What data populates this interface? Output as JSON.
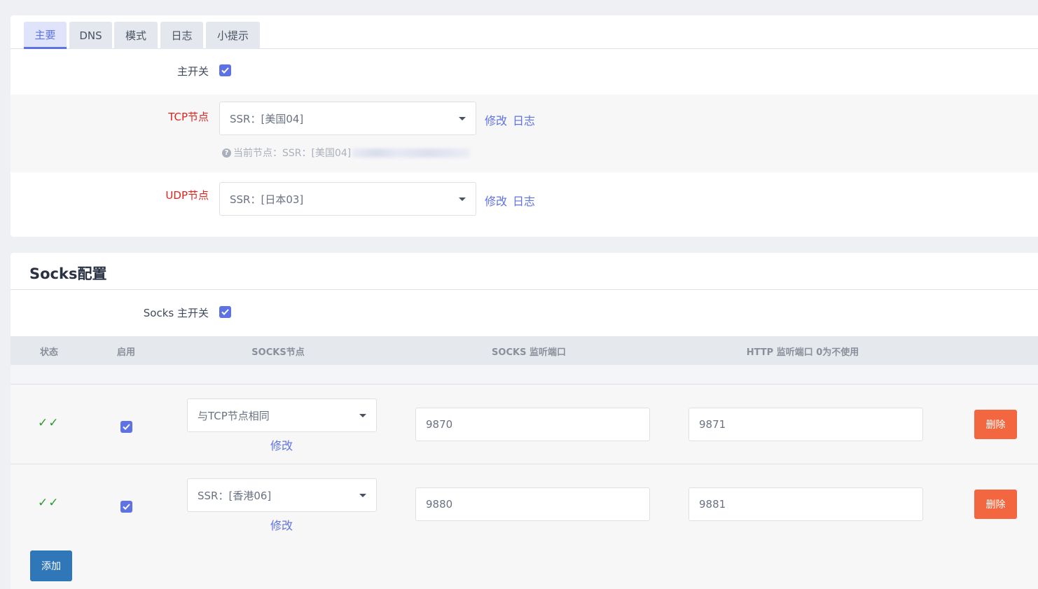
{
  "tabs": [
    {
      "label": "主要",
      "active": true
    },
    {
      "label": "DNS",
      "active": false
    },
    {
      "label": "模式",
      "active": false
    },
    {
      "label": "日志",
      "active": false
    },
    {
      "label": "小提示",
      "active": false
    }
  ],
  "main": {
    "master_switch": {
      "label": "主开关",
      "checked": true
    },
    "tcp_node": {
      "label": "TCP节点",
      "value": "SSR：[美国04]",
      "edit_link": "修改",
      "log_link": "日志",
      "current_hint": "当前节点：SSR：[美国04]"
    },
    "udp_node": {
      "label": "UDP节点",
      "value": "SSR：[日本03]",
      "edit_link": "修改",
      "log_link": "日志"
    }
  },
  "socks": {
    "title": "Socks配置",
    "master_switch": {
      "label": "Socks 主开关",
      "checked": true
    },
    "columns": [
      "状态",
      "启用",
      "SOCKS节点",
      "SOCKS 监听端口",
      "HTTP 监听端口 0为不使用"
    ],
    "rows": [
      {
        "status": "✓✓",
        "enabled": true,
        "node": "与TCP节点相同",
        "edit_link": "修改",
        "socks_port": "9870",
        "http_port": "9871",
        "delete_label": "删除"
      },
      {
        "status": "✓✓",
        "enabled": true,
        "node": "SSR：[香港06]",
        "edit_link": "修改",
        "socks_port": "9880",
        "http_port": "9881",
        "delete_label": "删除"
      }
    ],
    "add_label": "添加"
  },
  "colors": {
    "accent": "#5e72e4",
    "required_label": "#e0231c",
    "delete_button": "#f2673f",
    "add_button": "#2f77b8",
    "status_ok": "#2e9a2e"
  }
}
